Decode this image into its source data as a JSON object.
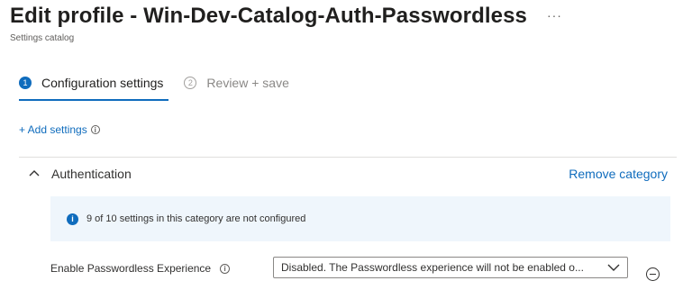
{
  "header": {
    "title": "Edit profile - Win-Dev-Catalog-Auth-Passwordless",
    "more_label": "···",
    "subtitle": "Settings catalog"
  },
  "steps": [
    {
      "number": "1",
      "label": "Configuration settings",
      "state": "active"
    },
    {
      "number": "2",
      "label": "Review + save",
      "state": "inactive"
    }
  ],
  "add_settings": {
    "label": "+ Add settings",
    "info_icon": "info-icon"
  },
  "category": {
    "title": "Authentication",
    "remove_label": "Remove category",
    "expanded": true,
    "info_banner": "9 of 10 settings in this category are not configured",
    "settings": [
      {
        "label": "Enable Passwordless Experience",
        "value": "Disabled. The Passwordless experience will not be enabled o..."
      }
    ]
  },
  "colors": {
    "accent": "#0f6cbd",
    "banner_bg": "#eff6fc",
    "text": "#323130"
  }
}
